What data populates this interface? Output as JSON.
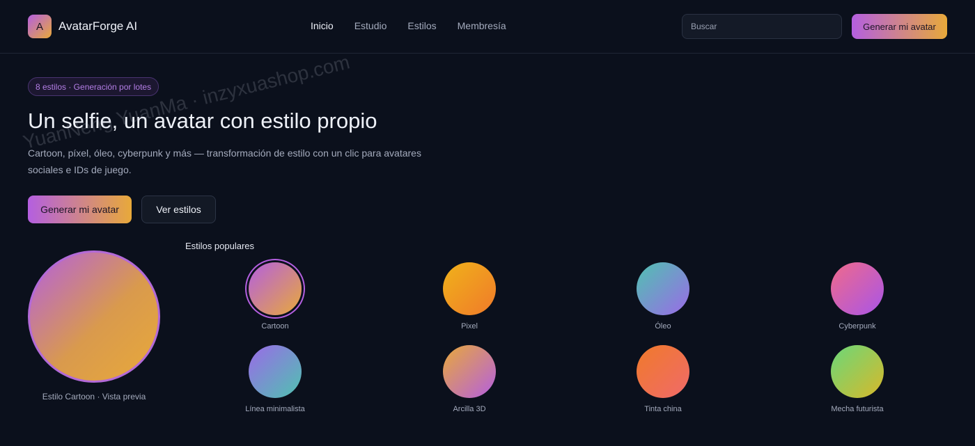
{
  "header": {
    "brand_letter": "A",
    "brand_name": "AvatarForge AI",
    "nav": [
      "Inicio",
      "Estudio",
      "Estilos",
      "Membresía"
    ],
    "search_placeholder": "Buscar",
    "cta_label": "Generar mi avatar"
  },
  "hero": {
    "badge": "8 estilos · Generación por lotes",
    "title": "Un selfie, un avatar con estilo propio",
    "subtitle": "Cartoon, píxel, óleo, cyberpunk y más — transformación de estilo con un clic para avatares sociales e IDs de juego.",
    "primary_cta": "Generar mi avatar",
    "secondary_cta": "Ver estilos"
  },
  "preview": {
    "label": "Estilo Cartoon · Vista previa"
  },
  "styles": {
    "heading": "Estilos populares",
    "items": [
      {
        "label": "Cartoon",
        "from": "#b45fe0",
        "to": "#e8a93a",
        "selected": true
      },
      {
        "label": "Pixel",
        "from": "#f0b21a",
        "to": "#f07a2a",
        "selected": false
      },
      {
        "label": "Óleo",
        "from": "#4fc2b0",
        "to": "#9b6ae8",
        "selected": false
      },
      {
        "label": "Cyberpunk",
        "from": "#f06a8a",
        "to": "#a855e8",
        "selected": false
      },
      {
        "label": "Línea minimalista",
        "from": "#9b6ae8",
        "to": "#4fc2b0",
        "selected": false
      },
      {
        "label": "Arcilla 3D",
        "from": "#e8a93a",
        "to": "#b45fe0",
        "selected": false
      },
      {
        "label": "Tinta china",
        "from": "#f07a2a",
        "to": "#f06a6a",
        "selected": false
      },
      {
        "label": "Mecha futurista",
        "from": "#6ad87a",
        "to": "#d8b82a",
        "selected": false
      }
    ]
  },
  "watermark": "YuanNeng YuanMa · inzyxuashop.com"
}
